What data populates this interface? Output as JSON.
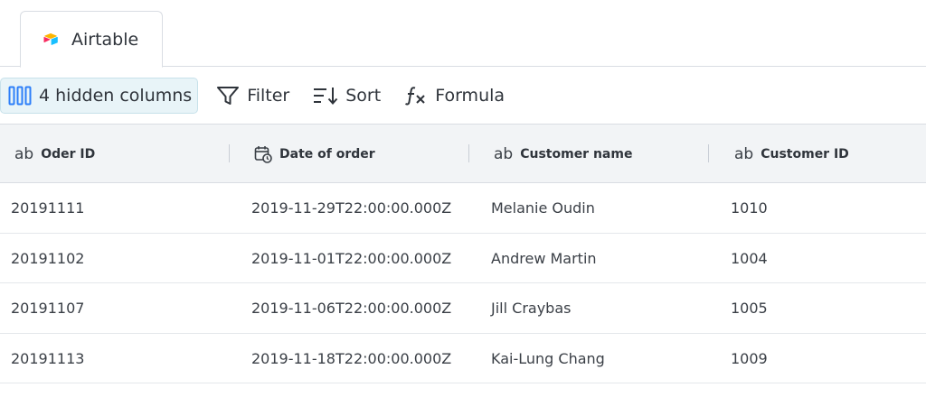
{
  "tab": {
    "label": "Airtable",
    "icon": "airtable-logo-icon"
  },
  "toolbar": {
    "hidden_columns_label": "4 hidden columns",
    "filter_label": "Filter",
    "sort_label": "Sort",
    "formula_label": "Formula"
  },
  "table": {
    "columns": [
      {
        "label": "Oder ID",
        "type_icon": "ab"
      },
      {
        "label": "Date of order",
        "type_icon": "calendar-clock-icon"
      },
      {
        "label": "Customer name",
        "type_icon": "ab"
      },
      {
        "label": "Customer ID",
        "type_icon": "ab"
      }
    ],
    "type_glyph": "ab",
    "rows": [
      [
        "20191111",
        "2019-11-29T22:00:00.000Z",
        "Melanie Oudin",
        "1010"
      ],
      [
        "20191102",
        "2019-11-01T22:00:00.000Z",
        "Andrew Martin",
        "1004"
      ],
      [
        "20191107",
        "2019-11-06T22:00:00.000Z",
        "Jill Craybas",
        "1005"
      ],
      [
        "20191113",
        "2019-11-18T22:00:00.000Z",
        "Kai-Lung Chang",
        "1009"
      ]
    ]
  },
  "colors": {
    "hidden_columns_bg": "#e8f4f8",
    "header_bg": "#f2f4f6",
    "icon_blue": "#2d7ff9"
  }
}
